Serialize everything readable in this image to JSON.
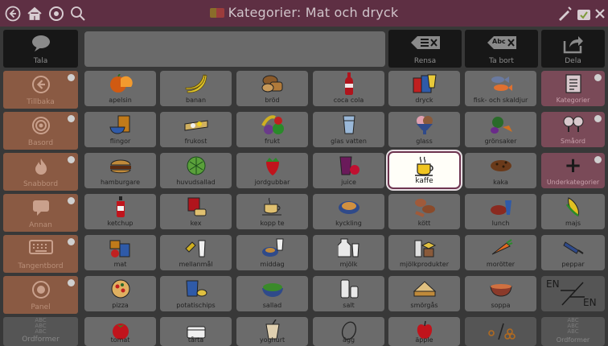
{
  "window": {
    "title": "Kategorier: Mat och dryck",
    "icons": [
      "back-icon",
      "home-icon",
      "settings-icon",
      "search-icon",
      "edit-icon",
      "lock-icon",
      "close-icon"
    ]
  },
  "top_row": {
    "tala_label": "Tala",
    "rensa_label": "Rensa",
    "tabort_label": "Ta bort",
    "tabort_icon_text": "Abc",
    "dela_label": "Dela"
  },
  "side_menu": [
    {
      "label": "Tillbaka",
      "icon": "back-icon"
    },
    {
      "label": "Basord",
      "icon": "target-icon"
    },
    {
      "label": "Snabbord",
      "icon": "fire-icon"
    },
    {
      "label": "Annan",
      "icon": "chat-icon"
    },
    {
      "label": "Tangentbord",
      "icon": "keyboard-icon"
    },
    {
      "label": "Panel",
      "icon": "panel-icon"
    },
    {
      "label": "Ordformer",
      "icon": "abc-icon",
      "icon_text": [
        "ABC",
        "ABC",
        "ABC"
      ]
    }
  ],
  "grid": [
    [
      "apelsin",
      "banan",
      "bröd",
      "coca cola",
      "dryck",
      "fisk- och skaldjur"
    ],
    [
      "flingor",
      "frukost",
      "frukt",
      "glas vatten",
      "glass",
      "grönsaker"
    ],
    [
      "hamburgare",
      "huvudsallad",
      "jordgubbar",
      "juice",
      "kaffe",
      "kaka"
    ],
    [
      "ketchup",
      "kex",
      "kopp te",
      "kyckling",
      "kött",
      "lunch"
    ],
    [
      "mat",
      "mellanmål",
      "middag",
      "mjölk",
      "mjölkprodukter",
      "morötter"
    ],
    [
      "pizza",
      "potatischips",
      "sallad",
      "salt",
      "smörgås",
      "soppa"
    ],
    [
      "tomat",
      "tårta",
      "yoghurt",
      "ägg",
      "äpple",
      ""
    ]
  ],
  "right_column": [
    {
      "label": "Kategorier"
    },
    {
      "label": "Småord"
    },
    {
      "label": "Underkategorier",
      "symbol": "+"
    },
    {
      "label": "majs"
    },
    {
      "label": "peppar"
    },
    {
      "label": "",
      "symbol_text": [
        "EN",
        "EN"
      ]
    },
    {
      "label": "Ordformer",
      "symbol_text": [
        "ABC",
        "ABC",
        "ABC"
      ]
    }
  ],
  "selected_item": "kaffe",
  "colors": {
    "titlebar": "#5e2f43",
    "side_menu": "#8a5a43",
    "category_button": "#7a4a58",
    "highlight_border": "#6e3550"
  }
}
